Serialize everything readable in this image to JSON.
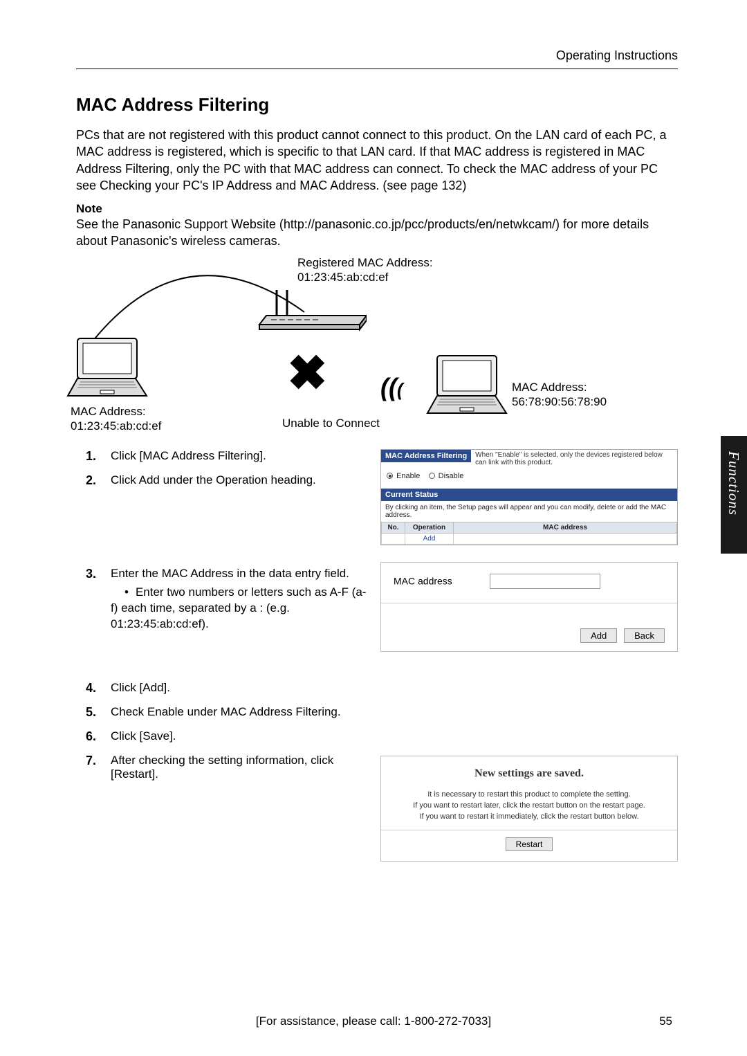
{
  "header": {
    "doc_title": "Operating Instructions"
  },
  "section": {
    "title": "MAC Address Filtering",
    "intro": "PCs that are not registered with this product cannot connect to this product. On the LAN card of each PC, a MAC address is registered, which is specific to that LAN card. If that MAC address is registered in MAC Address Filtering, only the PC with that MAC address can connect. To check the MAC address of your PC see Checking your PC's IP Address and MAC Address. (see page 132)",
    "note_label": "Note",
    "note_body": "See the Panasonic Support Website (http://panasonic.co.jp/pcc/products/en/netwkcam/) for more details about Panasonic's wireless cameras."
  },
  "diagram": {
    "reg_label": "Registered MAC Address:",
    "reg_mac": "01:23:45:ab:cd:ef",
    "left_mac_label": "MAC Address:",
    "left_mac": "01:23:45:ab:cd:ef",
    "right_mac_label": "MAC Address:",
    "right_mac": "56:78:90:56:78:90",
    "unable": "Unable to Connect",
    "x": "✖"
  },
  "steps": [
    {
      "num": "1.",
      "text": "Click [MAC Address Filtering]."
    },
    {
      "num": "2.",
      "text": "Click Add under the Operation heading."
    },
    {
      "num": "3.",
      "text": "Enter the MAC Address in the data entry field.",
      "sub": [
        "Enter two numbers or letters such as A-F (a-f) each time, separated by a : (e.g. 01:23:45:ab:cd:ef)."
      ]
    },
    {
      "num": "4.",
      "text": "Click [Add]."
    },
    {
      "num": "5.",
      "text": "Check Enable under MAC Address Filtering."
    },
    {
      "num": "6.",
      "text": "Click [Save]."
    },
    {
      "num": "7.",
      "text": "After checking the setting information, click [Restart]."
    }
  ],
  "mini": {
    "title": "MAC Address Filtering",
    "desc": "When \"Enable\" is selected, only the devices registered below can link with this product.",
    "enable": "Enable",
    "disable": "Disable",
    "status_title": "Current Status",
    "status_hint": "By clicking an item, the Setup pages will appear and you can modify, delete or add the MAC address.",
    "col_no": "No.",
    "col_op": "Operation",
    "col_mac": "MAC address",
    "add_link": "Add"
  },
  "entry": {
    "label": "MAC address",
    "add_btn": "Add",
    "back_btn": "Back"
  },
  "saved": {
    "title": "New settings are saved.",
    "body_l1": "It is necessary to restart this product to complete the setting.",
    "body_l2": "If you want to restart later, click the restart button on the restart page.",
    "body_l3": "If you want to restart it immediately, click the restart button below.",
    "restart_btn": "Restart"
  },
  "side_tab": "Functions",
  "footer": {
    "assist": "[For assistance, please call: 1-800-272-7033]",
    "page": "55"
  }
}
